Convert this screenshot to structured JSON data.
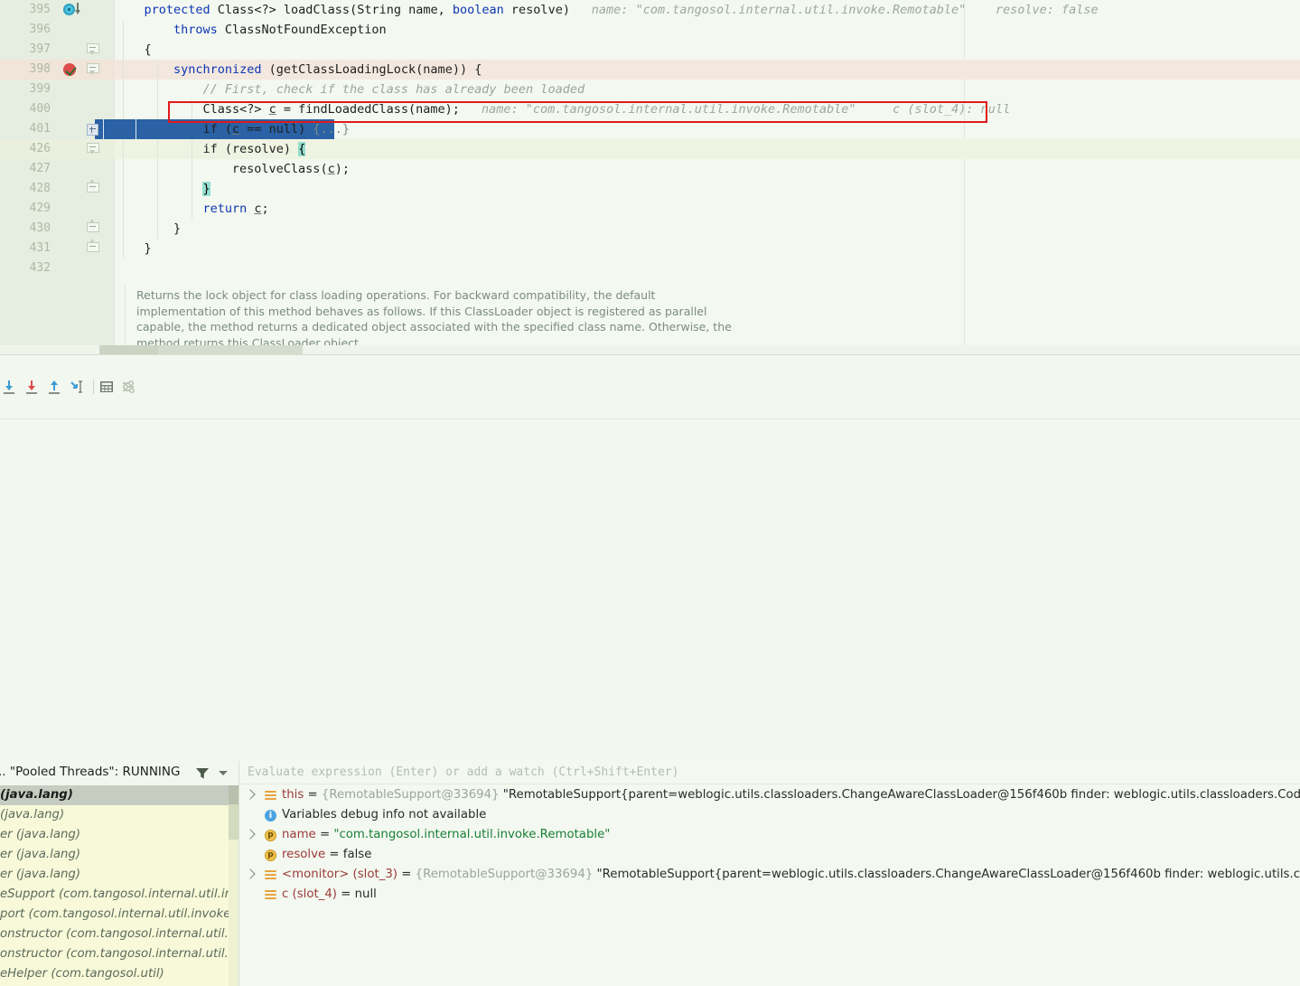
{
  "editor": {
    "lines": [
      {
        "num": "395",
        "indent": 4,
        "tokens": [
          {
            "t": "protected ",
            "c": "kw"
          },
          {
            "t": "Class",
            "c": "id"
          },
          {
            "t": "<?> ",
            "c": "id"
          },
          {
            "t": "loadClass",
            "c": "method"
          },
          {
            "t": "(",
            "c": "id"
          },
          {
            "t": "String",
            "c": "id"
          },
          {
            "t": " name, ",
            "c": "id"
          },
          {
            "t": "boolean",
            "c": "kw"
          },
          {
            "t": " resolve)",
            "c": "id"
          }
        ],
        "hint": "name: \"com.tangosol.internal.util.invoke.Remotable\"    resolve: false"
      },
      {
        "num": "396",
        "indent": 8,
        "tokens": [
          {
            "t": "throws ",
            "c": "kw"
          },
          {
            "t": "ClassNotFoundException",
            "c": "id"
          }
        ],
        "hint": ""
      },
      {
        "num": "397",
        "indent": 4,
        "tokens": [
          {
            "t": "{",
            "c": "id"
          }
        ],
        "hint": ""
      },
      {
        "num": "398",
        "indent": 8,
        "tokens": [
          {
            "t": "synchronized ",
            "c": "kw"
          },
          {
            "t": "(getClassLoadingLock(name)) {",
            "c": "id"
          }
        ],
        "hint": ""
      },
      {
        "num": "399",
        "indent": 12,
        "tokens": [
          {
            "t": "// First, check if the class has already been loaded",
            "c": "cmt"
          }
        ],
        "hint": ""
      },
      {
        "num": "400",
        "indent": 12,
        "tokens": [
          {
            "t": "Class<?> ",
            "c": "id"
          },
          {
            "t": "c",
            "c": "uline"
          },
          {
            "t": " = findLoadedClass(name);",
            "c": "id"
          }
        ],
        "hint": "name: \"com.tangosol.internal.util.invoke.Remotable\"     c (slot_4): null"
      },
      {
        "num": "401",
        "indent": 12,
        "tokens": [
          {
            "t": "if (",
            "c": "id"
          },
          {
            "t": "c",
            "c": "uline"
          },
          {
            "t": " == null) ",
            "c": "id"
          },
          {
            "t": "{...}",
            "c": "fold"
          }
        ],
        "hint": ""
      },
      {
        "num": "426",
        "indent": 12,
        "tokens": [
          {
            "t": "if (resolve) ",
            "c": "id"
          },
          {
            "t": "{",
            "c": "bracehl"
          }
        ],
        "hint": ""
      },
      {
        "num": "427",
        "indent": 16,
        "tokens": [
          {
            "t": "resolveClass(",
            "c": "id"
          },
          {
            "t": "c",
            "c": "uline"
          },
          {
            "t": ");",
            "c": "id"
          }
        ],
        "hint": ""
      },
      {
        "num": "428",
        "indent": 12,
        "tokens": [
          {
            "t": "}",
            "c": "bracehl"
          }
        ],
        "hint": ""
      },
      {
        "num": "429",
        "indent": 12,
        "tokens": [
          {
            "t": "return ",
            "c": "kw"
          },
          {
            "t": "c",
            "c": "uline"
          },
          {
            "t": ";",
            "c": "id"
          }
        ],
        "hint": ""
      },
      {
        "num": "430",
        "indent": 8,
        "tokens": [
          {
            "t": "}",
            "c": "id"
          }
        ],
        "hint": ""
      },
      {
        "num": "431",
        "indent": 4,
        "tokens": [
          {
            "t": "}",
            "c": "id"
          }
        ],
        "hint": ""
      },
      {
        "num": "432",
        "indent": 0,
        "tokens": [],
        "hint": ""
      }
    ],
    "doc_popup": [
      "Returns the lock object for class loading operations. For backward compatibility, the default",
      "implementation of this method behaves as follows. If this ClassLoader object is registered as parallel",
      "capable, the method returns a dedicated object associated with the specified class name. Otherwise, the",
      "method returns this ClassLoader object."
    ],
    "annotation_color": "#e01b1b",
    "selected_line": "401",
    "breakpoint_line": "398"
  },
  "debug_toolbar": {
    "buttons": [
      {
        "name": "step-over-button",
        "label": "Step Over",
        "color": "#3a9bd4"
      },
      {
        "name": "step-into-button",
        "label": "Step Into",
        "color": "#dd4b4b"
      },
      {
        "name": "step-out-button",
        "label": "Step Out",
        "color": "#3a9bd4"
      },
      {
        "name": "run-to-cursor-button",
        "label": "Run to Cursor",
        "color": "#3a9bd4"
      },
      {
        "name": "evaluate-expression-button",
        "label": "Evaluate Expression",
        "color": "#6a7668"
      },
      {
        "name": "settings-button",
        "label": "Layout Settings",
        "color": "#b7c1b2"
      }
    ]
  },
  "frames": {
    "thread_label": ".. \"Pooled Threads\": RUNNING",
    "filter_label": "Filter",
    "dropdown_label": "Thread selector",
    "rows": [
      {
        "text": "(java.lang)",
        "selected": true
      },
      {
        "text": " (java.lang)",
        "selected": false
      },
      {
        "text": "er (java.lang)",
        "selected": false
      },
      {
        "text": "er (java.lang)",
        "selected": false
      },
      {
        "text": "er (java.lang)",
        "selected": false
      },
      {
        "text": "eSupport (com.tangosol.internal.util.invo",
        "selected": false
      },
      {
        "text": "port (com.tangosol.internal.util.invoke)",
        "selected": false
      },
      {
        "text": "onstructor (com.tangosol.internal.util.ir",
        "selected": false
      },
      {
        "text": "onstructor (com.tangosol.internal.util.in",
        "selected": false
      },
      {
        "text": "eHelper (com.tangosol.util)",
        "selected": false
      }
    ]
  },
  "variables": {
    "evaluate_placeholder": "Evaluate expression (Enter) or add a watch (Ctrl+Shift+Enter)",
    "rows": [
      {
        "icon": "field-icon",
        "expandable": true,
        "indent": 0,
        "segments": [
          {
            "t": "this",
            "c": "vname"
          },
          {
            "t": " = ",
            "c": "veq"
          },
          {
            "t": "{RemotableSupport@33694} ",
            "c": "vref"
          },
          {
            "t": "\"RemotableSupport{parent=weblogic.utils.classloaders.ChangeAwareClassLoader@156f460b finder: weblogic.utils.classloaders.Cod",
            "c": "vplain"
          }
        ]
      },
      {
        "icon": "info-icon",
        "expandable": false,
        "indent": 0,
        "segments": [
          {
            "t": "Variables debug info not available",
            "c": "vinfo"
          }
        ]
      },
      {
        "icon": "parameter-icon",
        "expandable": true,
        "indent": 0,
        "segments": [
          {
            "t": "name",
            "c": "vname"
          },
          {
            "t": " = ",
            "c": "veq"
          },
          {
            "t": "\"com.tangosol.internal.util.invoke.Remotable\"",
            "c": "vstr"
          }
        ]
      },
      {
        "icon": "parameter-icon",
        "expandable": false,
        "indent": 0,
        "segments": [
          {
            "t": "resolve",
            "c": "vname"
          },
          {
            "t": " = ",
            "c": "veq"
          },
          {
            "t": "false",
            "c": "vplain"
          }
        ]
      },
      {
        "icon": "field-icon",
        "expandable": true,
        "indent": 0,
        "segments": [
          {
            "t": "<monitor> (slot_3)",
            "c": "vname"
          },
          {
            "t": " = ",
            "c": "veq"
          },
          {
            "t": "{RemotableSupport@33694} ",
            "c": "vref"
          },
          {
            "t": "\"RemotableSupport{parent=weblogic.utils.classloaders.ChangeAwareClassLoader@156f460b finder: weblogic.utils.cla",
            "c": "vplain"
          }
        ]
      },
      {
        "icon": "field-icon",
        "expandable": false,
        "indent": 0,
        "segments": [
          {
            "t": "c (slot_4)",
            "c": "vname"
          },
          {
            "t": " = ",
            "c": "veq"
          },
          {
            "t": "null",
            "c": "vplain"
          }
        ]
      }
    ]
  }
}
